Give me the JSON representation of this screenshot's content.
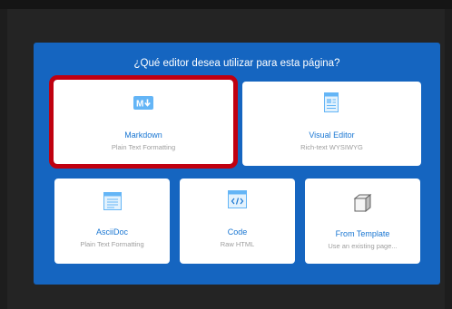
{
  "dialog": {
    "title": "¿Qué editor desea utilizar para esta página?"
  },
  "editors": [
    {
      "name": "Markdown",
      "desc": "Plain Text Formatting",
      "icon": "markdown-icon",
      "selected": true
    },
    {
      "name": "Visual Editor",
      "desc": "Rich-text WYSIWYG",
      "icon": "document-icon",
      "selected": false
    },
    {
      "name": "AsciiDoc",
      "desc": "Plain Text Formatting",
      "icon": "list-document-icon",
      "selected": false
    },
    {
      "name": "Code",
      "desc": "Raw HTML",
      "icon": "code-icon",
      "selected": false
    },
    {
      "name": "From Template",
      "desc": "Use an existing page...",
      "icon": "cube-icon",
      "selected": false
    }
  ],
  "colors": {
    "dialog_bg": "#1565c0",
    "accent": "#1976d2",
    "selection_outline": "#c00010"
  }
}
